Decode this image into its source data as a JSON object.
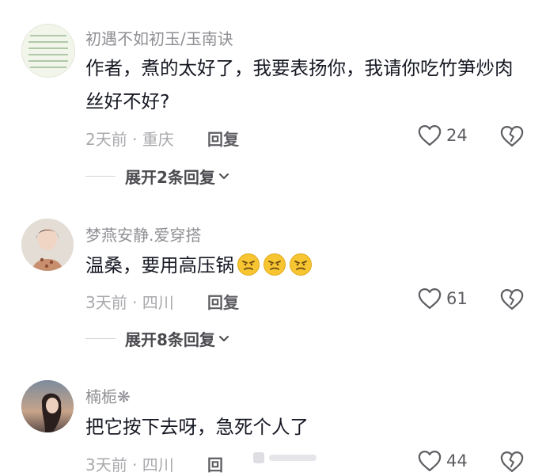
{
  "comments": [
    {
      "author": "初遇不如初玉/玉南诀",
      "text": "作者，煮的太好了，我要表扬你，我请你吃竹笋炒肉丝好不好?",
      "meta": "2天前 · 重庆",
      "reply_label": "回复",
      "likes": "24",
      "expand_label": "展开2条回复"
    },
    {
      "author": "梦燕安静.爱穿搭",
      "text": "温桑，要用高压锅",
      "emojis": [
        "angry-face-emoji",
        "angry-face-emoji",
        "angry-face-emoji"
      ],
      "meta": "3天前 · 四川",
      "reply_label": "回复",
      "likes": "61",
      "expand_label": "展开8条回复"
    },
    {
      "author": "楠栀❋",
      "text": "把它按下去呀，急死个人了",
      "meta": "3天前 · 四川",
      "reply_label": "回",
      "likes": "44"
    }
  ],
  "icons": {
    "like": "heart-outline-icon",
    "dislike": "broken-heart-icon",
    "expand": "chevron-down-icon"
  },
  "colors": {
    "text": "#161823",
    "muted": "#a9a9ad",
    "emoji_yellow": "#f7c531"
  }
}
